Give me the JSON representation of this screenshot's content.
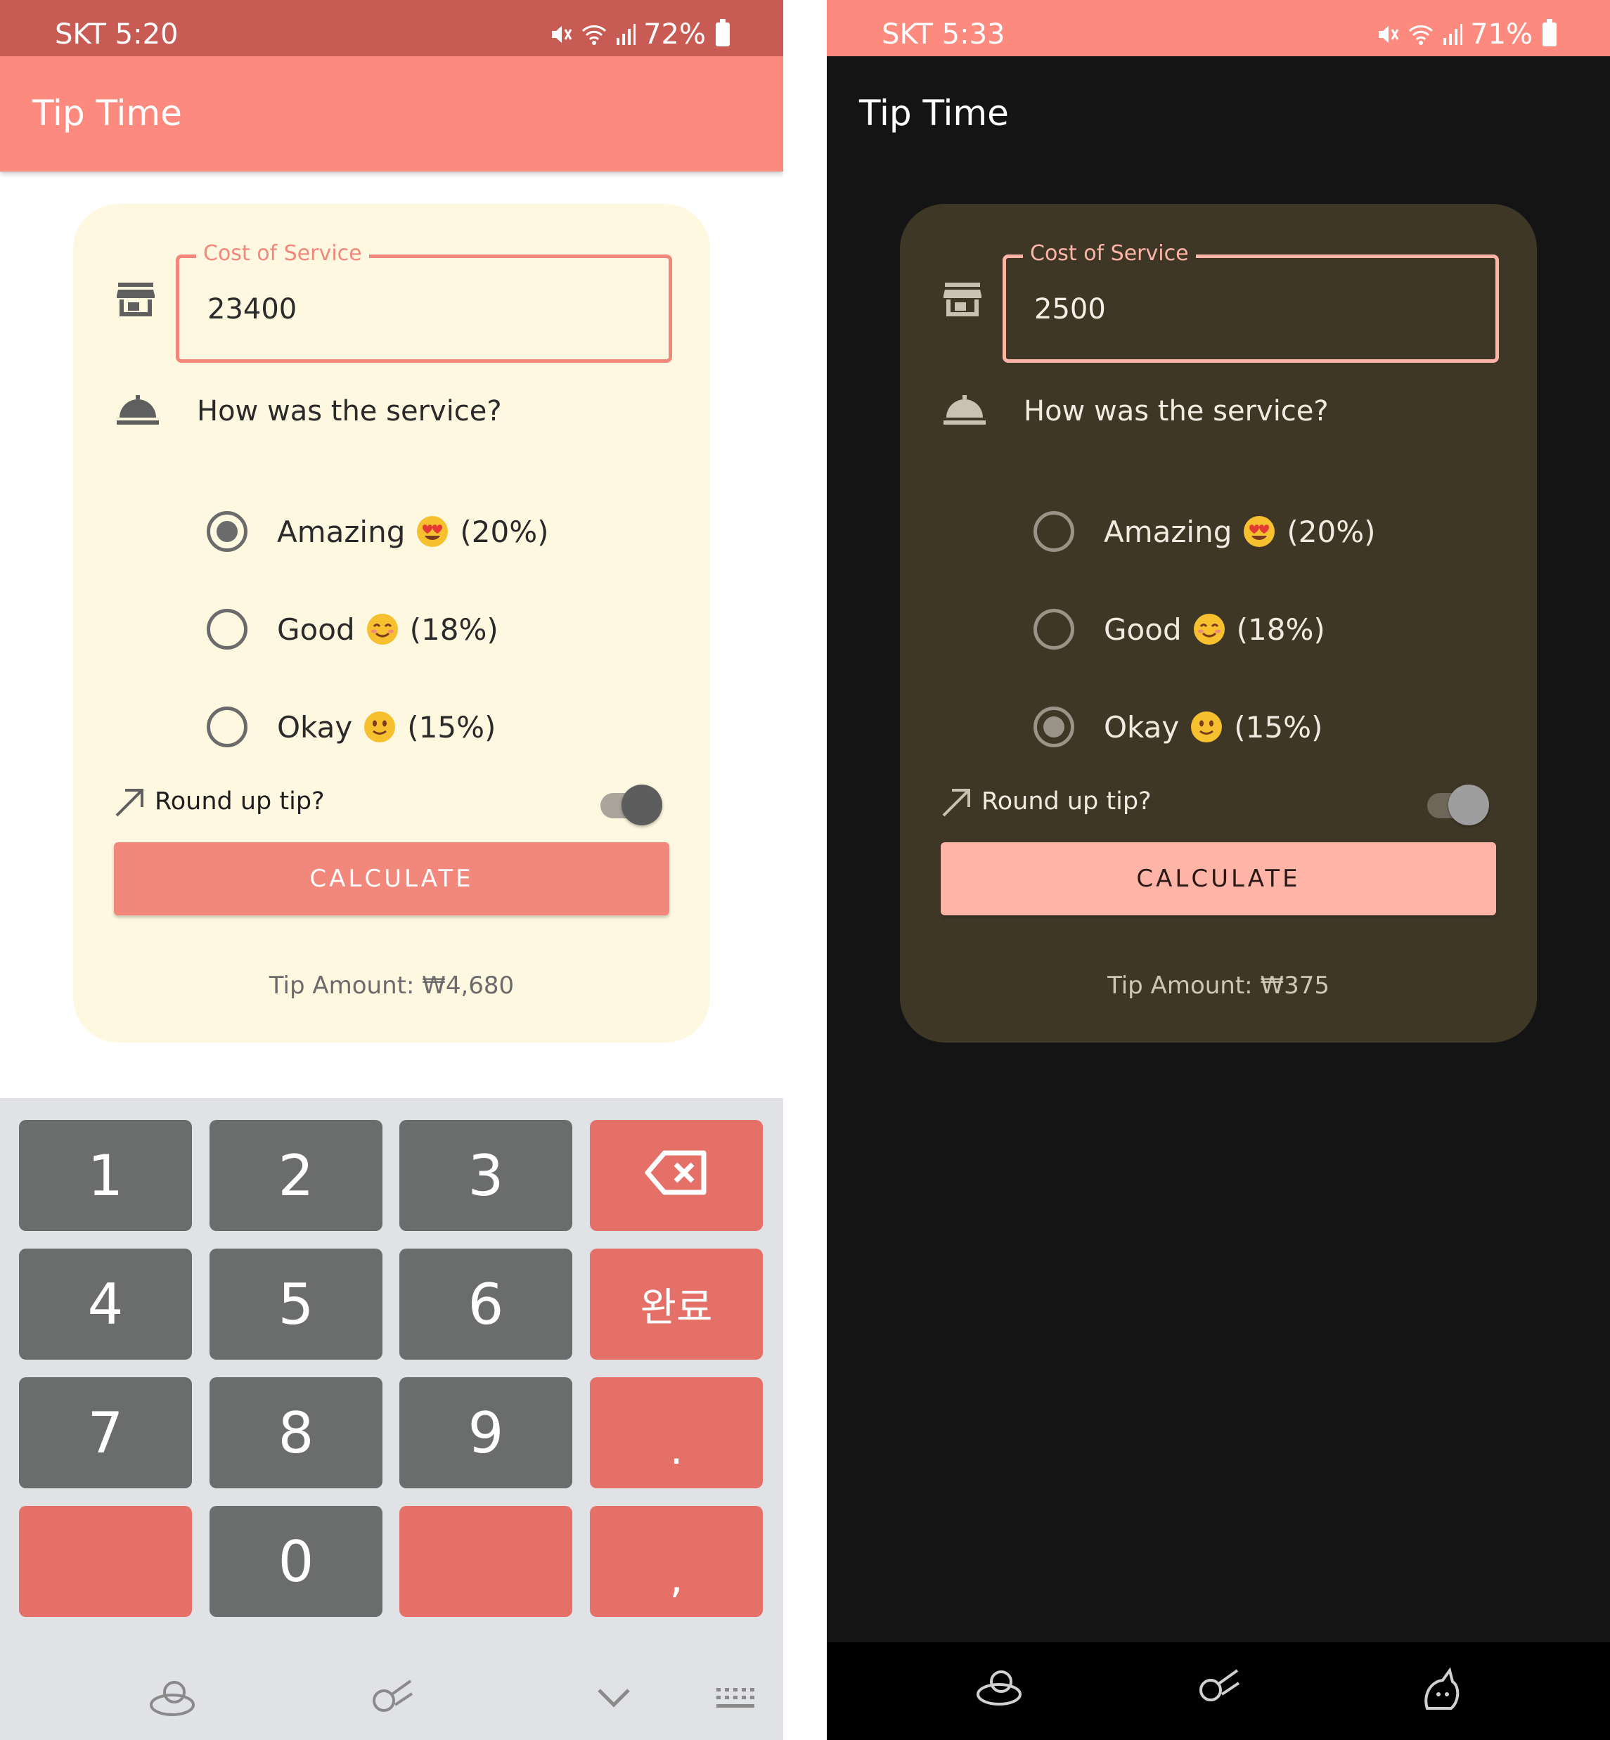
{
  "left": {
    "status": {
      "carrier_time": "SKT 5:20",
      "battery": "72%"
    },
    "app_title": "Tip Time",
    "cost_label": "Cost of Service",
    "cost_value": "23400",
    "question": "How was the service?",
    "options": [
      {
        "label": "Amazing",
        "pct": "(20%)",
        "emoji": "heart-eyes",
        "selected": true
      },
      {
        "label": "Good",
        "pct": "(18%)",
        "emoji": "smiling",
        "selected": false
      },
      {
        "label": "Okay",
        "pct": "(15%)",
        "emoji": "slight-smile",
        "selected": false
      }
    ],
    "roundup_label": "Round up tip?",
    "roundup_on": true,
    "calculate_label": "CALCULATE",
    "tip_amount": "Tip Amount: ₩4,680",
    "keyboard": {
      "keys": [
        "1",
        "2",
        "3",
        "",
        "4",
        "5",
        "6",
        "완료",
        "7",
        "8",
        "9",
        ".",
        "",
        "0",
        "",
        ","
      ]
    }
  },
  "right": {
    "status": {
      "carrier_time": "SKT 5:33",
      "battery": "71%"
    },
    "app_title": "Tip Time",
    "cost_label": "Cost of Service",
    "cost_value": "2500",
    "question": "How was the service?",
    "options": [
      {
        "label": "Amazing",
        "pct": "(20%)",
        "emoji": "heart-eyes",
        "selected": false
      },
      {
        "label": "Good",
        "pct": "(18%)",
        "emoji": "smiling",
        "selected": false
      },
      {
        "label": "Okay",
        "pct": "(15%)",
        "emoji": "slight-smile",
        "selected": true
      }
    ],
    "roundup_label": "Round up tip?",
    "roundup_on": true,
    "calculate_label": "CALCULATE",
    "tip_amount": "Tip Amount: ₩375"
  },
  "colors": {
    "primary": "#fd8a7e",
    "status_light": "#c85c55",
    "card_light": "#fff8e1",
    "card_dark": "#3f3726",
    "button_light": "#f2877c",
    "button_dark": "#ffb4a8",
    "key_gray": "#6b6d6c",
    "key_accent": "#e57068"
  }
}
